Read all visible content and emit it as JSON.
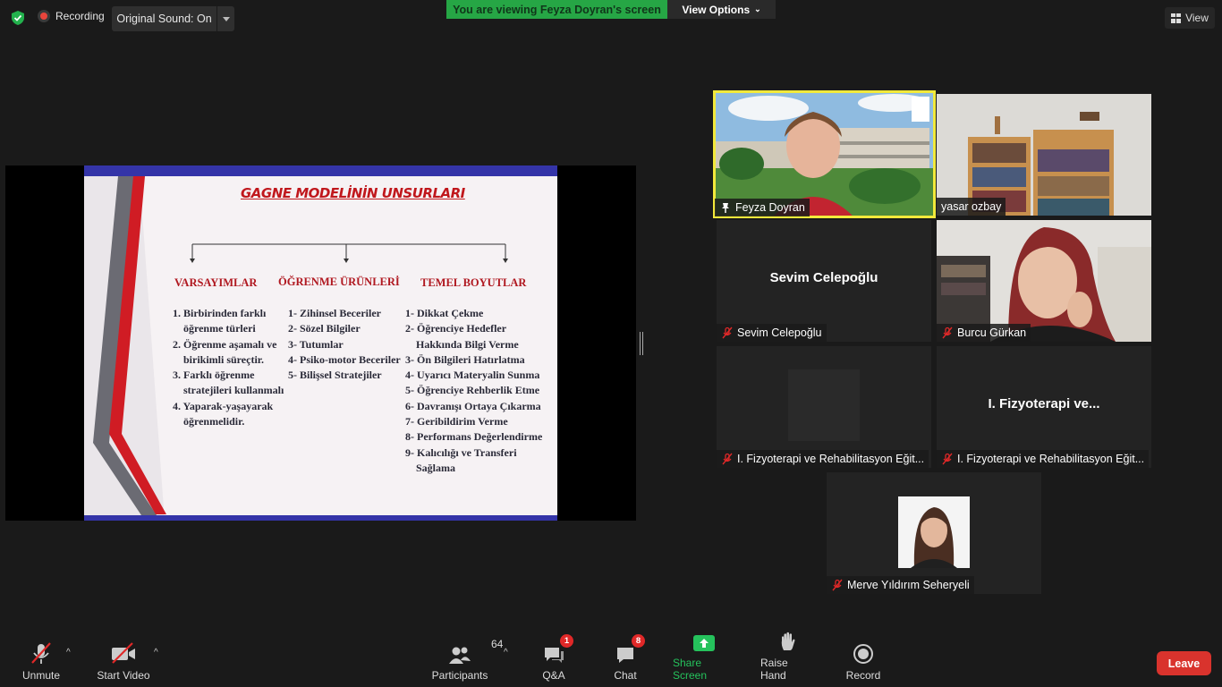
{
  "top_bar": {
    "recording_label": "Recording",
    "sound_button": "Original Sound: On",
    "viewing_banner": "You are viewing Feyza Doyran's screen",
    "view_options": "View Options",
    "view_label": "View"
  },
  "slide": {
    "title": "GAGNE MODELİNİN UNSURLARI",
    "columns": [
      {
        "heading": "VARSAYIMLAR",
        "items": [
          "1. Birbirinden farklı",
          "öğrenme türleri",
          "2. Öğrenme aşamalı ve",
          "birikimli süreçtir.",
          "3. Farklı öğrenme",
          "stratejileri kullanmalı",
          "4. Yaparak-yaşayarak",
          "öğrenmelidir."
        ]
      },
      {
        "heading": "ÖĞRENME ÜRÜNLERİ",
        "items": [
          "1- Zihinsel Beceriler",
          "2- Sözel Bilgiler",
          "3- Tutumlar",
          "4- Psiko-motor Beceriler",
          "5- Bilişsel Stratejiler"
        ]
      },
      {
        "heading": "TEMEL BOYUTLAR",
        "items": [
          "1- Dikkat Çekme",
          "2- Öğrenciye Hedefler",
          "Hakkında Bilgi Verme",
          "3- Ön Bilgileri Hatırlatma",
          "4- Uyarıcı Materyalin Sunma",
          "5- Öğrenciye Rehberlik Etme",
          "6- Davranışı Ortaya Çıkarma",
          "7- Geribildirim Verme",
          "8- Performans Değerlendirme",
          "9- Kalıcılığı ve Transferi",
          "Sağlama"
        ]
      }
    ]
  },
  "participants_tiles": [
    {
      "name": "Feyza Doyran",
      "center_text": "",
      "muted": false,
      "pinned": true,
      "active_speaker": true
    },
    {
      "name": "yasar ozbay",
      "center_text": "",
      "muted": false
    },
    {
      "name": "Sevim Celepoğlu",
      "center_text": "Sevim Celepoğlu",
      "muted": true
    },
    {
      "name": "Burcu Gürkan",
      "center_text": "",
      "muted": true
    },
    {
      "name": "I. Fizyoterapi ve Rehabilitasyon Eğit...",
      "center_text": "",
      "muted": true
    },
    {
      "name": "I. Fizyoterapi ve Rehabilitasyon Eğit...",
      "center_text": "I. Fizyoterapi ve...",
      "muted": true
    },
    {
      "name": "Merve Yıldırım Seheryeli",
      "center_text": "",
      "muted": true
    }
  ],
  "toolbar": {
    "unmute": "Unmute",
    "start_video": "Start Video",
    "participants": "Participants",
    "participants_count": "64",
    "qa": "Q&A",
    "qa_badge": "1",
    "chat": "Chat",
    "chat_badge": "8",
    "share_screen": "Share Screen",
    "raise_hand": "Raise Hand",
    "record": "Record",
    "leave": "Leave"
  },
  "colors": {
    "background": "#1a1a1a",
    "banner_green": "#26a645",
    "active_speaker": "#f2e93b",
    "leave_red": "#d9332d",
    "slide_title_red": "#c0171c",
    "share_green": "#25c25c"
  }
}
